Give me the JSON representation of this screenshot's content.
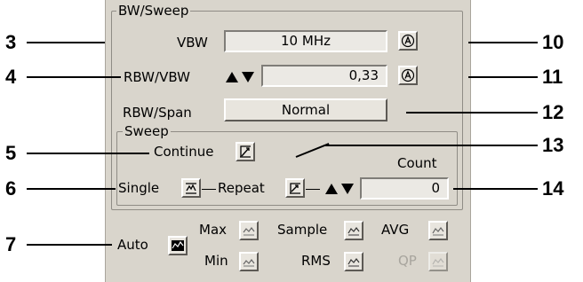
{
  "bw_sweep": {
    "group_title": "BW/Sweep",
    "vbw_label": "VBW",
    "vbw_value": "10 MHz",
    "rbw_vbw_label": "RBW/VBW",
    "rbw_vbw_value": "0,33",
    "rbw_span_label": "RBW/Span",
    "rbw_span_value": "Normal"
  },
  "sweep": {
    "group_title": "Sweep",
    "continue_label": "Continue",
    "single_label": "Single",
    "repeat_label": "Repeat",
    "count_label": "Count",
    "count_value": "0"
  },
  "detector": {
    "auto_label": "Auto",
    "max_label": "Max",
    "min_label": "Min",
    "sample_label": "Sample",
    "rms_label": "RMS",
    "avg_label": "AVG",
    "qp_label": "QP"
  },
  "callouts": [
    "3",
    "4",
    "5",
    "6",
    "7",
    "10",
    "11",
    "12",
    "13",
    "14"
  ],
  "colors": {
    "panel": "#d9d5cc",
    "disabled_text": "#a8a59e",
    "field": "#ebe9e4"
  }
}
